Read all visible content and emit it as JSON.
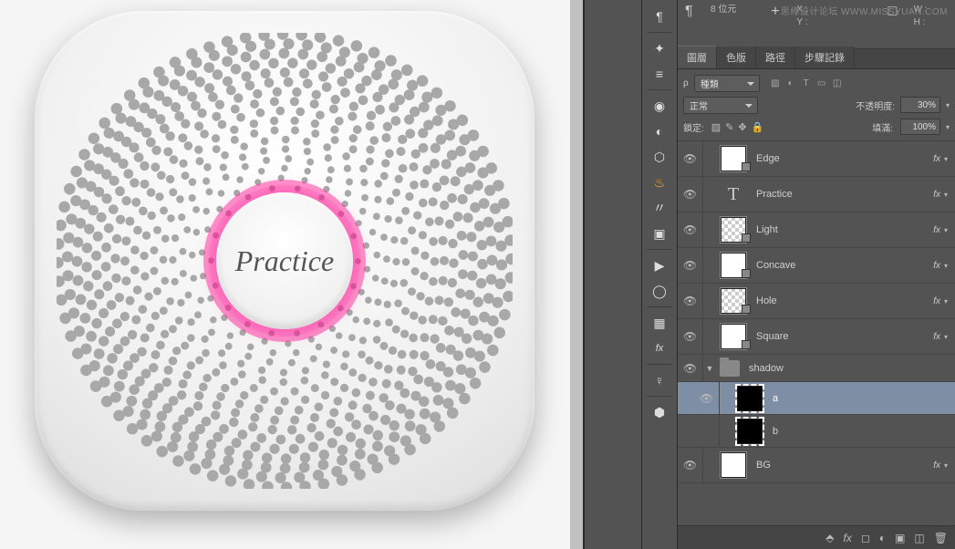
{
  "info_panel": {
    "header_text": "8 位元",
    "x_label": "X :",
    "y_label": "Y :",
    "w_label": "W :",
    "h_label": "H :"
  },
  "tabs": {
    "layers": "圖層",
    "channels": "色版",
    "paths": "路徑",
    "history": "步驟記錄"
  },
  "layer_controls": {
    "kind_prefix": "ρ",
    "kind_value": "種類",
    "blend_mode": "正常",
    "opacity_label": "不透明度:",
    "opacity_value": "30%",
    "lock_label": "鎖定:",
    "fill_label": "填滿:",
    "fill_value": "100%"
  },
  "layers": [
    {
      "name": "Edge",
      "type": "shape",
      "fx": true,
      "visible": true
    },
    {
      "name": "Practice",
      "type": "text",
      "fx": true,
      "visible": true
    },
    {
      "name": "Light",
      "type": "shape",
      "fx": true,
      "visible": true,
      "hatch": true
    },
    {
      "name": "Concave",
      "type": "shape",
      "fx": true,
      "visible": true
    },
    {
      "name": "Hole",
      "type": "shape",
      "fx": true,
      "visible": true,
      "hatch": true
    },
    {
      "name": "Square",
      "type": "shape",
      "fx": true,
      "visible": true
    },
    {
      "name": "shadow",
      "type": "group",
      "fx": false,
      "visible": true
    },
    {
      "name": "a",
      "type": "sub-shape",
      "fx": false,
      "visible": true,
      "selected": true
    },
    {
      "name": "b",
      "type": "sub-shape",
      "fx": false,
      "visible": false
    },
    {
      "name": "BG",
      "type": "bg",
      "fx": true,
      "visible": true
    }
  ],
  "canvas": {
    "center_text": "Practice"
  },
  "watermark": "思缘设计论坛  WWW.MISSYUAN.COM"
}
